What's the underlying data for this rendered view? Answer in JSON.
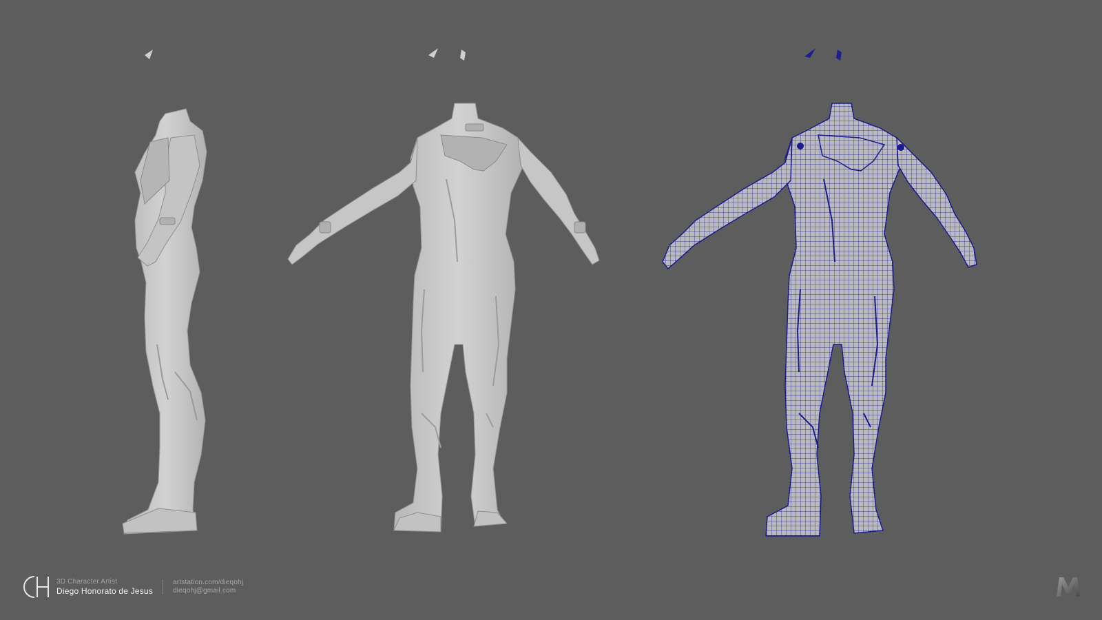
{
  "viewport": {
    "background": "#5d5d5d",
    "model_color": "#c9c9c9",
    "model_shadow": "#9e9e9e",
    "wire_color": "#1c1a8c"
  },
  "views": [
    {
      "name": "side-view",
      "shading": "clay"
    },
    {
      "name": "back-view",
      "shading": "clay"
    },
    {
      "name": "back-wireframe-view",
      "shading": "wireframe"
    }
  ],
  "footer": {
    "logo_icon": "dh-monogram-icon",
    "role": "3D Character Artist",
    "name": "Diego Honorato de Jesus",
    "website": "artstation.com/dieqohj",
    "email": "dieqohj@gmail.com"
  },
  "software_logo": {
    "icon": "maya-logo-icon"
  }
}
